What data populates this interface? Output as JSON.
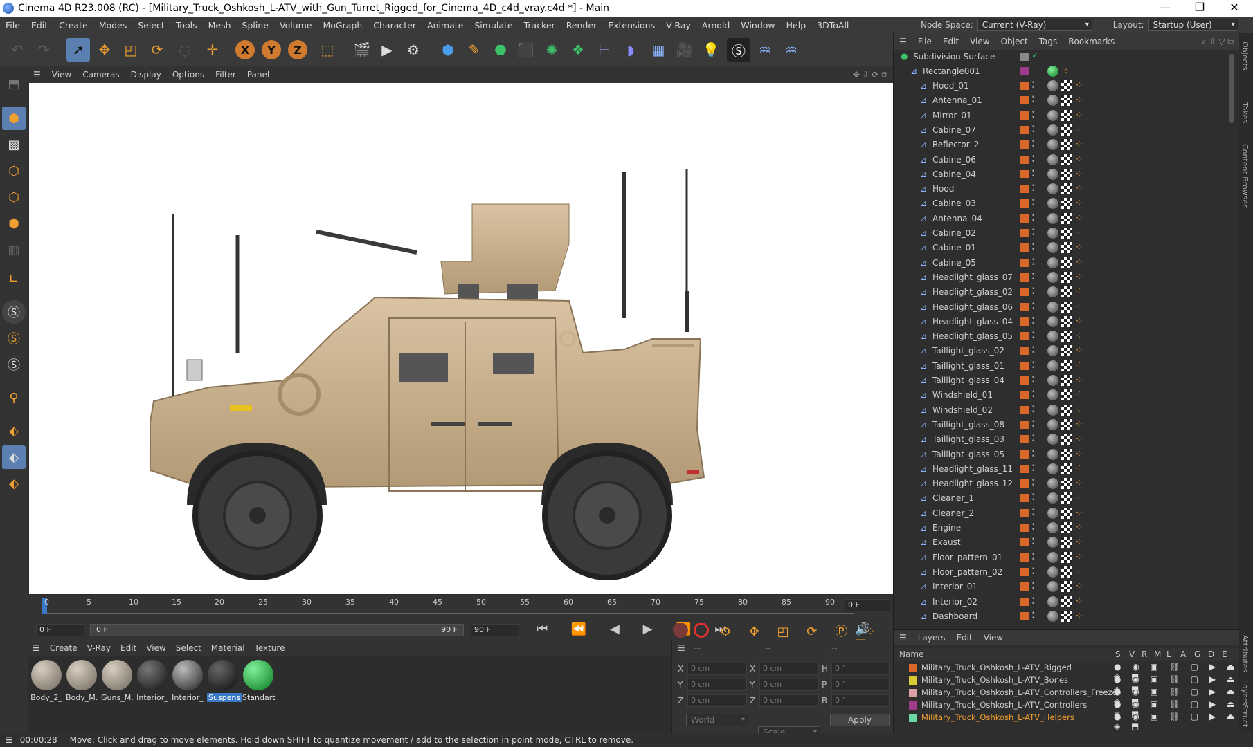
{
  "window": {
    "title": "Cinema 4D R23.008 (RC) - [Military_Truck_Oshkosh_L-ATV_with_Gun_Turret_Rigged_for_Cinema_4D_c4d_vray.c4d *] - Main",
    "minimize": "—",
    "maximize": "❐",
    "close": "✕"
  },
  "menu": [
    "File",
    "Edit",
    "Create",
    "Modes",
    "Select",
    "Tools",
    "Mesh",
    "Spline",
    "Volume",
    "MoGraph",
    "Character",
    "Animate",
    "Simulate",
    "Tracker",
    "Render",
    "Extensions",
    "V-Ray",
    "Arnold",
    "Window",
    "Help",
    "3DToAll"
  ],
  "topright": {
    "node_space_label": "Node Space:",
    "node_space_value": "Current (V-Ray)",
    "layout_label": "Layout:",
    "layout_value": "Startup (User)"
  },
  "viewport_menu": [
    "View",
    "Cameras",
    "Display",
    "Options",
    "Filter",
    "Panel"
  ],
  "timeline": {
    "ticks": [
      "0",
      "5",
      "10",
      "15",
      "20",
      "25",
      "30",
      "35",
      "40",
      "45",
      "50",
      "55",
      "60",
      "65",
      "70",
      "75",
      "80",
      "85",
      "90"
    ],
    "frame_field": "0 F"
  },
  "playbar": {
    "start": "0 F",
    "current": "0 F",
    "end_a": "90 F",
    "end_b": "90 F"
  },
  "material_menu": [
    "Create",
    "V-Ray",
    "Edit",
    "View",
    "Select",
    "Material",
    "Texture"
  ],
  "materials": [
    {
      "label": "Body_2_",
      "color": "#8a7f73"
    },
    {
      "label": "Body_M.",
      "color": "#8a7f73"
    },
    {
      "label": "Guns_M.",
      "color": "#8a7f73"
    },
    {
      "label": "Interior_",
      "color": "#333333"
    },
    {
      "label": "Interior_",
      "color": "#555555"
    },
    {
      "label": "Suspens",
      "color": "#222222"
    },
    {
      "label": "Standart",
      "color": "#22aa33"
    }
  ],
  "coords": {
    "dashes": [
      "--",
      "--",
      "--"
    ],
    "rows": [
      {
        "a": "X",
        "av": "0 cm",
        "b": "X",
        "bv": "0 cm",
        "c": "H",
        "cv": "0 °"
      },
      {
        "a": "Y",
        "av": "0 cm",
        "b": "Y",
        "bv": "0 cm",
        "c": "P",
        "cv": "0 °"
      },
      {
        "a": "Z",
        "av": "0 cm",
        "b": "Z",
        "bv": "0 cm",
        "c": "B",
        "cv": "0 °"
      }
    ],
    "world": "World",
    "scale": "Scale",
    "apply": "Apply"
  },
  "objects_menu": [
    "File",
    "Edit",
    "View",
    "Object",
    "Tags",
    "Bookmarks"
  ],
  "objects_root": "Subdivision Surface",
  "objects_group": "Rectangle001",
  "objects": [
    "Hood_01",
    "Antenna_01",
    "Mirror_01",
    "Cabine_07",
    "Reflector_2",
    "Cabine_06",
    "Cabine_04",
    "Hood",
    "Cabine_03",
    "Antenna_04",
    "Cabine_02",
    "Cabine_01",
    "Cabine_05",
    "Headlight_glass_07",
    "Headlight_glass_02",
    "Headlight_glass_06",
    "Headlight_glass_04",
    "Headlight_glass_05",
    "Taillight_glass_02",
    "Taillight_glass_01",
    "Taillight_glass_04",
    "Windshield_01",
    "Windshield_02",
    "Taillight_glass_08",
    "Taillight_glass_03",
    "Taillight_glass_05",
    "Headlight_glass_11",
    "Headlight_glass_12",
    "Cleaner_1",
    "Cleaner_2",
    "Engine",
    "Exaust",
    "Floor_pattern_01",
    "Floor_pattern_02",
    "Interior_01",
    "Interior_02",
    "Dashboard"
  ],
  "layers_menu": [
    "Layers",
    "Edit",
    "View"
  ],
  "layers_header": {
    "name": "Name",
    "cols": [
      "S",
      "V",
      "R",
      "M",
      "L",
      "A",
      "G",
      "D",
      "E"
    ]
  },
  "layers": [
    {
      "name": "Military_Truck_Oshkosh_L-ATV_Rigged",
      "color": "#d9672a",
      "highlight": false
    },
    {
      "name": "Military_Truck_Oshkosh_L-ATV_Bones",
      "color": "#d8c832",
      "highlight": false
    },
    {
      "name": "Military_Truck_Oshkosh_L-ATV_Controllers_Freeze",
      "color": "#d9a0a8",
      "highlight": false
    },
    {
      "name": "Military_Truck_Oshkosh_L-ATV_Controllers",
      "color": "#a03a8a",
      "highlight": false
    },
    {
      "name": "Military_Truck_Oshkosh_L-ATV_Helpers",
      "color": "#6ad8a0",
      "highlight": true
    }
  ],
  "side_tabs": [
    "Objects",
    "Takes",
    "Content Browser",
    "Attributes",
    "Layers",
    "Struct"
  ],
  "status": {
    "time": "00:00:28",
    "message": "Move: Click and drag to move elements. Hold down SHIFT to quantize movement / add to the selection in point mode, CTRL to remove."
  }
}
